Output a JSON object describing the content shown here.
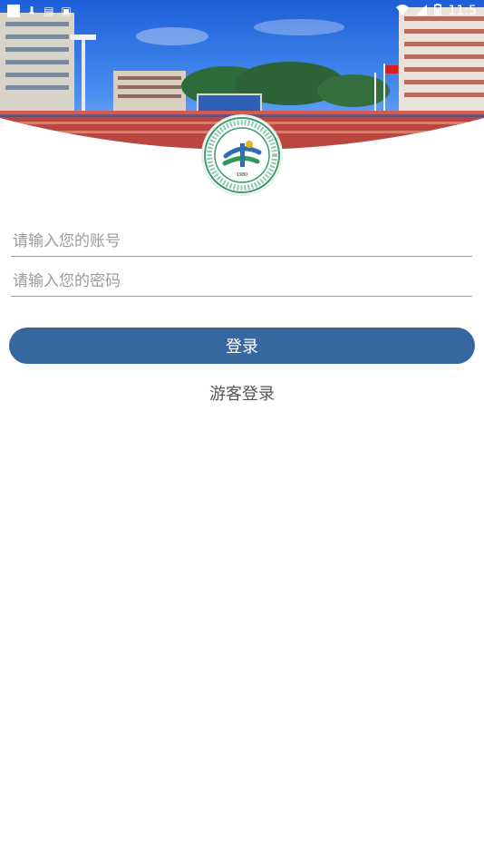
{
  "status_bar": {
    "time": "11:5",
    "icons": [
      "notification-square-icon",
      "download-icon",
      "chat-icon",
      "app-icon",
      "wifi-icon",
      "signal-icon",
      "battery-icon"
    ]
  },
  "login": {
    "account_placeholder": "请输入您的账号",
    "password_placeholder": "请输入您的密码",
    "login_label": "登录",
    "guest_label": "游客登录"
  },
  "logo": {
    "year": "1980"
  },
  "colors": {
    "primary": "#37679f",
    "underline": "#9aa3ad",
    "placeholder": "#9b9b9b"
  }
}
